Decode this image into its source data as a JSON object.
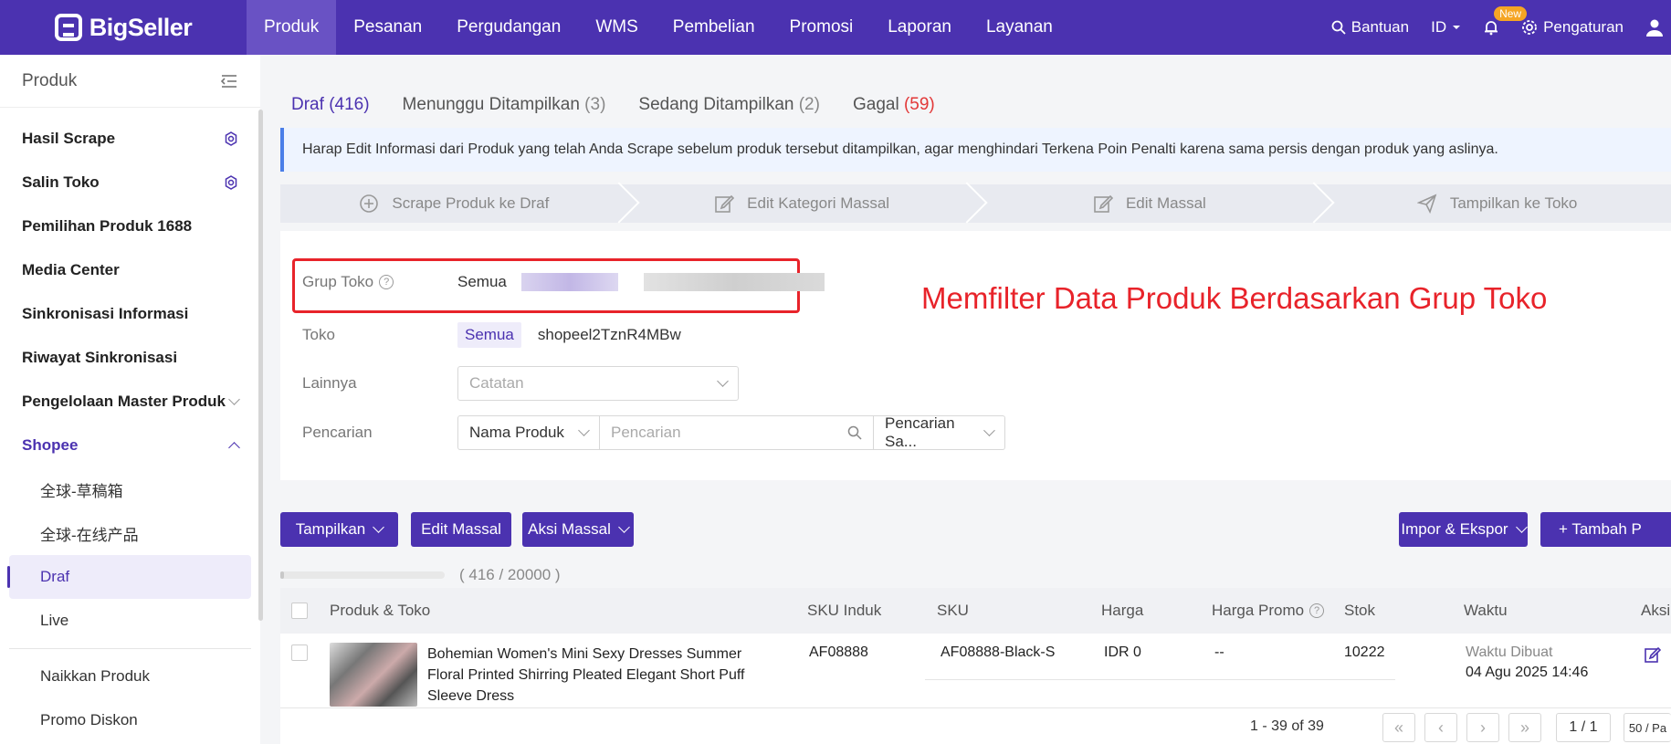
{
  "brand": {
    "name": "BigSeller"
  },
  "topnav": {
    "items": [
      "Produk",
      "Pesanan",
      "Pergudangan",
      "WMS",
      "Pembelian",
      "Promosi",
      "Laporan",
      "Layanan"
    ],
    "help": "Bantuan",
    "lang": "ID",
    "new_badge": "New",
    "settings": "Pengaturan"
  },
  "sidebar": {
    "title": "Produk",
    "items": [
      "Hasil Scrape",
      "Salin Toko",
      "Pemilihan Produk 1688",
      "Media Center",
      "Sinkronisasi Informasi",
      "Riwayat Sinkronisasi",
      "Pengelolaan Master Produk",
      "Shopee"
    ],
    "sub_items": [
      "全球-草稿箱",
      "全球-在线产品",
      "Draf",
      "Live"
    ],
    "bottom_items": [
      "Naikkan Produk",
      "Promo Diskon"
    ]
  },
  "tabs": [
    {
      "label": "Draf",
      "count": "(416)"
    },
    {
      "label": "Menunggu Ditampilkan",
      "count": "(3)"
    },
    {
      "label": "Sedang Ditampilkan",
      "count": "(2)"
    },
    {
      "label": "Gagal",
      "count": "(59)"
    }
  ],
  "notice": "Harap Edit Informasi dari Produk yang telah Anda Scrape sebelum produk tersebut ditampilkan, agar menghindari Terkena Poin Penalti karena sama persis dengan produk yang aslinya.",
  "steps": [
    "Scrape Produk ke Draf",
    "Edit Kategori Massal",
    "Edit Massal",
    "Tampilkan ke Toko"
  ],
  "filter": {
    "group_label": "Grup Toko",
    "group_value": "Semua",
    "store_label": "Toko",
    "store_all": "Semua",
    "store_name": "shopeel2TznR4MBw",
    "other_label": "Lainnya",
    "other_placeholder": "Catatan",
    "search_label": "Pencarian",
    "search_field": "Nama Produk",
    "search_placeholder": "Pencarian",
    "search_mode": "Pencarian Sa..."
  },
  "annotation": "Memfilter Data Produk Berdasarkan Grup Toko",
  "actions": {
    "display": "Tampilkan",
    "bulk_edit": "Edit Massal",
    "bulk_action": "Aksi Massal",
    "import_export": "Impor & Ekspor",
    "add": "+ Tambah P"
  },
  "progress": {
    "text": "( 416 / 20000 )",
    "fraction": 0.0208
  },
  "table": {
    "headers": [
      "Produk & Toko",
      "SKU Induk",
      "SKU",
      "Harga",
      "Harga Promo",
      "Stok",
      "Waktu",
      "Aksi"
    ],
    "row": {
      "title": "Bohemian Women's Mini Sexy Dresses Summer Floral Printed Shirring Pleated Elegant Short Puff Sleeve Dress",
      "parent_sku": "AF08888",
      "sku": "AF08888-Black-S",
      "price": "IDR 0",
      "promo": "--",
      "stock": "10222",
      "time_label": "Waktu Dibuat",
      "time_value": "04 Agu 2025 14:46"
    }
  },
  "pager": {
    "range": "1 - 39 of 39",
    "page": "1 / 1",
    "size": "50 / Pa"
  }
}
